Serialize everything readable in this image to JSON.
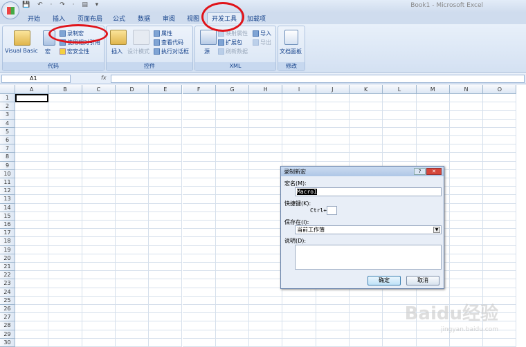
{
  "window": {
    "title": "Book1 - Microsoft Excel",
    "qat": "💾 ↶ · ↷ · ▤ ▾"
  },
  "tabs": [
    "开始",
    "插入",
    "页面布局",
    "公式",
    "数据",
    "审阅",
    "视图",
    "开发工具",
    "加载项"
  ],
  "active_tab": "开发工具",
  "ribbon": {
    "code": {
      "label": "代码",
      "visual_basic": "Visual Basic",
      "macros": "宏",
      "record_macro": "录制宏",
      "relative_ref": "使用相对引用",
      "macro_security": "宏安全性"
    },
    "controls": {
      "label": "控件",
      "insert": "插入",
      "design_mode": "设计模式",
      "properties": "属性",
      "view_code": "查看代码",
      "run_dialog": "执行对话框"
    },
    "xml": {
      "label": "XML",
      "source": "源",
      "map_properties": "映射属性",
      "expansion_packs": "扩展包",
      "refresh_data": "刷新数据",
      "import": "导入",
      "export": "导出"
    },
    "modify": {
      "label": "修改",
      "document_panel": "文档面板"
    }
  },
  "formula_bar": {
    "name_box": "A1",
    "fx": "fx",
    "formula": ""
  },
  "grid": {
    "columns": [
      "A",
      "B",
      "C",
      "D",
      "E",
      "F",
      "G",
      "H",
      "I",
      "J",
      "K",
      "L",
      "M",
      "N",
      "O"
    ],
    "rows": 30,
    "selected": "A1"
  },
  "dialog": {
    "title": "录制新宏",
    "help": "?",
    "close": "✕",
    "macro_name_label": "宏名(M):",
    "macro_name": "Macro1",
    "shortcut_label": "快捷键(K):",
    "ctrl": "Ctrl+",
    "shortcut": "",
    "store_label": "保存在(I):",
    "store_value": "当前工作簿",
    "desc_label": "说明(D):",
    "description": "",
    "ok": "确定",
    "cancel": "取消"
  },
  "watermark": {
    "text": "Baidu经验",
    "sub": "jingyan.baidu.com"
  }
}
